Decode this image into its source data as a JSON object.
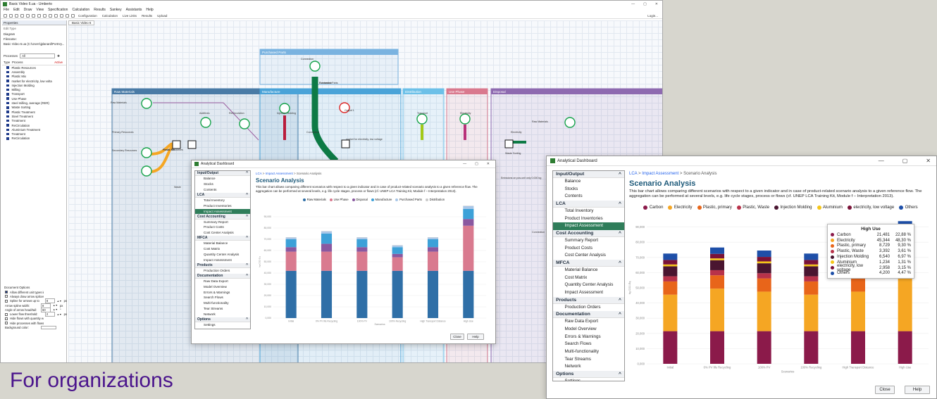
{
  "main": {
    "title": "Basic Video 6.ua - Umberto",
    "menu": [
      "File",
      "Edit",
      "Draw",
      "View",
      "Specification",
      "Calculation",
      "Results",
      "Sankey",
      "Assistants",
      "Help"
    ],
    "toolbar": [
      "Configuration",
      "Calculation",
      "Live Links",
      "Results",
      "Upload"
    ],
    "login": "Login...",
    "tab": "Basic Video 6",
    "properties": {
      "title": "Properties",
      "subtitle": "Edit Type",
      "diagram": "Diagram",
      "filename_label": "Filename:",
      "filename": "Basic Video 6.ua (C:\\Users\\jplanard\\Portnry...",
      "filter_label": "Processes",
      "filter_value": "All",
      "col_type": "Type",
      "col_process": "Process",
      "col_active": "Active",
      "processes": [
        "Plastic Resources",
        "Assembly",
        "Plastic Mix",
        "market for electricity, low volta",
        "Injection Molding",
        "Milling",
        "Transport",
        "Use Phase",
        "steel milling, average (RER)",
        "Waste Sorting",
        "Plastic Treatment",
        "Steel Treatment",
        "Treatment",
        "ReCirculation",
        "Aluminium Treatment",
        "Treatment",
        "ReCirculation"
      ],
      "doc_options_title": "Document Options",
      "doc_options": [
        "Allow different unit types in arrow (process",
        "Always draw arrow splices",
        "Spline for arrows up to",
        "Arrow spline width:",
        "Angle of arrow head/tail:",
        "Lower flow threshold:",
        "Hide flows with quantity equal to zero",
        "Hide processes with flows equal to zero",
        "Background color:"
      ],
      "doc_values": [
        "8",
        "8",
        "60",
        "2"
      ],
      "doc_units": [
        "px",
        "px",
        "°",
        "px"
      ]
    },
    "regions": [
      {
        "name": "Raw Materials",
        "color": "#4a7ba6"
      },
      {
        "name": "Manufacture",
        "color": "#4aa3d8"
      },
      {
        "name": "Distribution",
        "color": "#6cc0e8"
      },
      {
        "name": "Use Phase",
        "color": "#d9798e"
      },
      {
        "name": "Disposal",
        "color": "#8e6ab0"
      },
      {
        "name": "Purchased Parts",
        "color": "#7ab3e0"
      }
    ],
    "node_labels": [
      "Raw Materials",
      "Primary Resources",
      "Secondary Resources",
      "Plastic Resources",
      "Additives",
      "ReCirculation",
      "Injection Molding",
      "Output 1",
      "market for electricity, low voltage",
      "Connection",
      "Transport",
      "Electricity",
      "Electricity",
      "Waste Sorting",
      "Connection",
      "Purchased Parts",
      "Emissions on pos.unit only 0.000 kg",
      "Waste",
      "Raw Materials",
      "Connection",
      "Connection",
      "Plastic Mix"
    ]
  },
  "dash_small": {
    "title": "Analytical Dashboard",
    "breadcrumb": [
      "LCA",
      ">",
      "Impact Assessment",
      ">",
      "Scenario Analysis"
    ],
    "heading": "Scenario Analysis",
    "description": "This bar chart allows comparing  different scenarios with respect to a given indicator and in case of product-related scenario analysis to a given reference flow.  The aggregation can be performed at several levels, e.g. life cycle stages, process or flows (cf. UNEP LCA Training Kit, Module f – Interpretation 2013).",
    "close": "Close",
    "help": "Help"
  },
  "dash_big": {
    "title": "Analytical Dashboard",
    "breadcrumb": [
      "LCA",
      ">",
      "Impact Assessment",
      ">",
      "Scenario Analysis"
    ],
    "heading": "Scenario Analysis",
    "description": "This bar chart allows comparing  different scenarios with respect to a given indicator and in case of product-related scenario analysis to a given reference flow.  The aggregation can be performed at several levels, e.g. life cycle stages, process or flows (cf. UNEP LCA Training Kit, Module f – Interpretation 2013).",
    "close": "Close",
    "help": "Help"
  },
  "nav": [
    {
      "section": "Input/Output",
      "items": [
        "Balance",
        "Stocks",
        "Contents"
      ]
    },
    {
      "section": "LCA",
      "items": [
        "Total Inventory",
        "Product Inventories",
        "Impact Assessment"
      ]
    },
    {
      "section": "Cost Accounting",
      "items": [
        "Summary Report",
        "Product Costs",
        "Cost Center Analysis"
      ]
    },
    {
      "section": "MFCA",
      "items": [
        "Material Balance",
        "Cost Matrix",
        "Quantity Center Analysis",
        "Impact Assessment"
      ]
    },
    {
      "section": "Products",
      "items": [
        "Production Orders"
      ]
    },
    {
      "section": "Documentation",
      "items": [
        "Raw Data Export",
        "Model Overview",
        "Errors & Warnings",
        "Search Flows",
        "Multi-functionality",
        "Tear Streams",
        "Network"
      ]
    },
    {
      "section": "Options",
      "items": [
        "Settings"
      ]
    }
  ],
  "nav_active": "Impact Assessment",
  "chart_data": [
    {
      "type": "bar",
      "stacked": true,
      "categories": [
        "Initial",
        "0% PV life Recycling",
        "100% PV",
        "100% Recycling",
        "High Transport Distance",
        "High Use"
      ],
      "xlabel": "Scenarios",
      "ylabel": "kg CO2-Eq",
      "ylim": [
        0,
        100000
      ],
      "yticks": [
        "0,000",
        "10,000",
        "20,000",
        "30,000",
        "40,000",
        "50,000",
        "60,000",
        "70,000",
        "80,000",
        "90,000"
      ],
      "series": [
        {
          "name": "Raw Materials",
          "color": "#2f6fa7",
          "values": [
            42000,
            42000,
            42000,
            42000,
            42000,
            42000
          ]
        },
        {
          "name": "Use Phase",
          "color": "#d97a8f",
          "values": [
            17000,
            17000,
            17000,
            12000,
            17000,
            40000
          ]
        },
        {
          "name": "Disposal",
          "color": "#8a58a0",
          "values": [
            4000,
            7000,
            4000,
            3000,
            4000,
            6000
          ]
        },
        {
          "name": "Manufacture",
          "color": "#3da1d8",
          "values": [
            7000,
            9000,
            7000,
            6000,
            7000,
            9000
          ]
        },
        {
          "name": "Purchased Parts",
          "color": "#a9c7e8",
          "values": [
            1500,
            2000,
            1500,
            1500,
            1500,
            2500
          ]
        },
        {
          "name": "Distribution",
          "color": "#c9c9c9",
          "values": [
            300,
            300,
            300,
            300,
            300,
            300
          ]
        }
      ]
    },
    {
      "type": "bar",
      "stacked": true,
      "categories": [
        "Initial",
        "0% PV life Recycling",
        "100% PV",
        "100% Recycling",
        "High Transport Distance",
        "High Use"
      ],
      "xlabel": "Scenarios",
      "ylabel": "kg CO2-Eq",
      "ylim": [
        0,
        100000
      ],
      "yticks": [
        "0,000",
        "10,000",
        "20,000",
        "30,000",
        "40,000",
        "50,000",
        "60,000",
        "70,000",
        "80,000",
        "90,000"
      ],
      "series": [
        {
          "name": "Carbon",
          "color": "#8b1a4a",
          "values": [
            21481,
            21481,
            21481,
            21481,
            21481,
            21481
          ]
        },
        {
          "name": "Electricity",
          "color": "#f5a623",
          "values": [
            24000,
            28000,
            26000,
            24000,
            26000,
            45344
          ]
        },
        {
          "name": "Plastic, primary",
          "color": "#e8651a",
          "values": [
            8729,
            8729,
            8729,
            8729,
            8729,
            8729
          ]
        },
        {
          "name": "Plastic, Waste",
          "color": "#b8324a",
          "values": [
            3392,
            3392,
            3392,
            3392,
            3392,
            3392
          ]
        },
        {
          "name": "Injection Molding",
          "color": "#4a1530",
          "values": [
            6540,
            6540,
            6540,
            6540,
            6540,
            6540
          ]
        },
        {
          "name": "Aluminium",
          "color": "#f5c518",
          "values": [
            1234,
            1234,
            1234,
            1234,
            1234,
            1234
          ]
        },
        {
          "name": "electricity, low voltage",
          "color": "#7a1238",
          "values": [
            2958,
            2958,
            2958,
            2958,
            2958,
            2958
          ]
        },
        {
          "name": "Others",
          "color": "#1e4fa8",
          "values": [
            4200,
            4200,
            4200,
            4200,
            4200,
            4200
          ]
        }
      ],
      "tooltip": {
        "title": "High Use",
        "rows": [
          {
            "name": "Carbon",
            "value": "21,481",
            "pct": "22,88 %",
            "color": "#8b1a4a"
          },
          {
            "name": "Electricity",
            "value": "45,344",
            "pct": "48,30 %",
            "color": "#f5a623"
          },
          {
            "name": "Plastic, primary",
            "value": "8,729",
            "pct": "9,30 %",
            "color": "#e8651a"
          },
          {
            "name": "Plastic, Waste",
            "value": "3,392",
            "pct": "3,61 %",
            "color": "#b8324a"
          },
          {
            "name": "Injection Molding",
            "value": "6,540",
            "pct": "6,97 %",
            "color": "#4a1530"
          },
          {
            "name": "Aluminium",
            "value": "1,234",
            "pct": "1,31 %",
            "color": "#f5c518"
          },
          {
            "name": "electricity, low voltage",
            "value": "2,958",
            "pct": "3,15 %",
            "color": "#7a1238"
          },
          {
            "name": "Others",
            "value": "4,200",
            "pct": "4,47 %",
            "color": "#1e4fa8"
          }
        ]
      }
    }
  ],
  "slide_title": "For organizations"
}
